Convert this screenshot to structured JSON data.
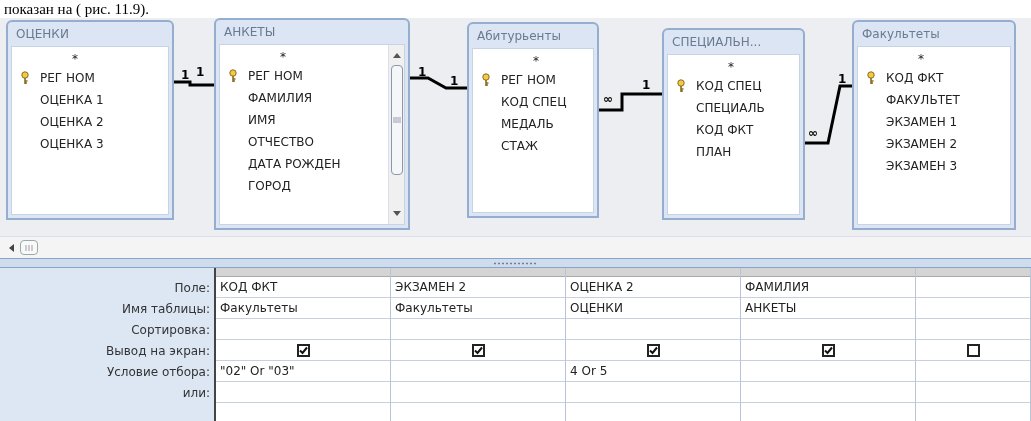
{
  "caption": "показан на ( рис. 11.9).",
  "tables": [
    {
      "title": "ОЦЕНКИ",
      "scrollbar": false,
      "fields": [
        {
          "name": "*",
          "key": false
        },
        {
          "name": "РЕГ НОМ",
          "key": true
        },
        {
          "name": "ОЦЕНКА 1",
          "key": false
        },
        {
          "name": "ОЦЕНКА 2",
          "key": false
        },
        {
          "name": "ОЦЕНКА 3",
          "key": false
        }
      ]
    },
    {
      "title": "АНКЕТЫ",
      "scrollbar": true,
      "fields": [
        {
          "name": "*",
          "key": false
        },
        {
          "name": "РЕГ НОМ",
          "key": true
        },
        {
          "name": "ФАМИЛИЯ",
          "key": false
        },
        {
          "name": "ИМЯ",
          "key": false
        },
        {
          "name": "ОТЧЕСТВО",
          "key": false
        },
        {
          "name": "ДАТА РОЖДЕН",
          "key": false
        },
        {
          "name": "ГОРОД",
          "key": false
        }
      ]
    },
    {
      "title": "Абитурьенты",
      "scrollbar": false,
      "fields": [
        {
          "name": "*",
          "key": false
        },
        {
          "name": "РЕГ НОМ",
          "key": true
        },
        {
          "name": "КОД СПЕЦ",
          "key": false
        },
        {
          "name": "МЕДАЛЬ",
          "key": false
        },
        {
          "name": "СТАЖ",
          "key": false
        }
      ]
    },
    {
      "title": "СПЕЦИАЛЬН...",
      "scrollbar": false,
      "fields": [
        {
          "name": "*",
          "key": false
        },
        {
          "name": "КОД СПЕЦ",
          "key": true
        },
        {
          "name": "СПЕЦИАЛЬ",
          "key": false
        },
        {
          "name": "КОД ФКТ",
          "key": false
        },
        {
          "name": "ПЛАН",
          "key": false
        }
      ]
    },
    {
      "title": "Факультеты",
      "scrollbar": false,
      "fields": [
        {
          "name": "*",
          "key": false
        },
        {
          "name": "КОД ФКТ",
          "key": true
        },
        {
          "name": "ФАКУЛЬТЕТ",
          "key": false
        },
        {
          "name": "ЭКЗАМЕН 1",
          "key": false
        },
        {
          "name": "ЭКЗАМЕН 2",
          "key": false
        },
        {
          "name": "ЭКЗАМЕН 3",
          "key": false
        }
      ]
    }
  ],
  "relationships": [
    {
      "left_label": "1",
      "right_label": "1"
    },
    {
      "left_label": "1",
      "right_label": "1"
    },
    {
      "left_label": "∞",
      "right_label": "1"
    },
    {
      "left_label": "∞",
      "right_label": "1"
    }
  ],
  "grid": {
    "row_labels": [
      "Поле:",
      "Имя таблицы:",
      "Сортировка:",
      "Вывод на экран:",
      "Условие отбора:",
      "или:"
    ],
    "columns": [
      {
        "field": "КОД ФКТ",
        "table": "Факультеты",
        "show": true,
        "criteria": "\"02\" Or \"03\""
      },
      {
        "field": "ЭКЗАМЕН 2",
        "table": "Факультеты",
        "show": true
      },
      {
        "field": "ОЦЕНКА 2",
        "table": "ОЦЕНКИ",
        "show": true,
        "criteria": "4 Or 5"
      },
      {
        "field": "ФАМИЛИЯ",
        "table": "АНКЕТЫ",
        "show": true
      },
      {
        "show": false
      }
    ]
  }
}
